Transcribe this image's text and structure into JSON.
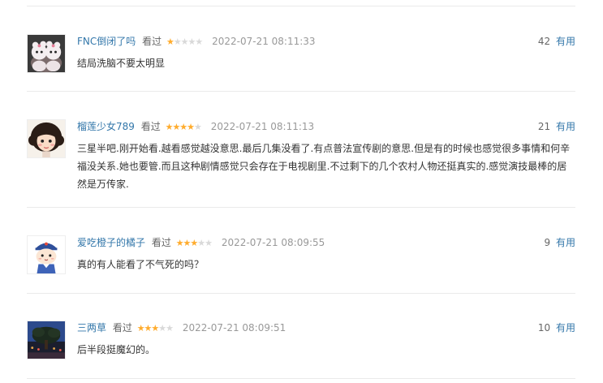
{
  "comments": [
    {
      "user": "FNC倒闭了吗",
      "action": "看过",
      "rating": 1,
      "time": "2022-07-21 08:11:33",
      "votes": "42",
      "useful_label": "有用",
      "text": "结局洗脑不要太明显"
    },
    {
      "user": "榴莲少女789",
      "action": "看过",
      "rating": 4,
      "time": "2022-07-21 08:11:13",
      "votes": "21",
      "useful_label": "有用",
      "text": "三星半吧.刚开始看.越看感觉越没意思.最后几集没看了.有点普法宣传剧的意思.但是有的时候也感觉很多事情和何辛福没关系.她也要管.而且这种剧情感觉只会存在于电视剧里.不过剩下的几个农村人物还挺真实的.感觉演技最棒的居然是万传家."
    },
    {
      "user": "爱吃橙子的橘子",
      "action": "看过",
      "rating": 3,
      "time": "2022-07-21 08:09:55",
      "votes": "9",
      "useful_label": "有用",
      "text": "真的有人能看了不气死的吗？"
    },
    {
      "user": "三两草",
      "action": "看过",
      "rating": 3,
      "time": "2022-07-21 08:09:51",
      "votes": "10",
      "useful_label": "有用",
      "text": "后半段挺魔幻的。"
    }
  ],
  "colors": {
    "link": "#3377aa",
    "star_on": "#ffac2d",
    "star_off": "#d9d9d9",
    "time": "#999999",
    "divider": "#eaeaea"
  }
}
